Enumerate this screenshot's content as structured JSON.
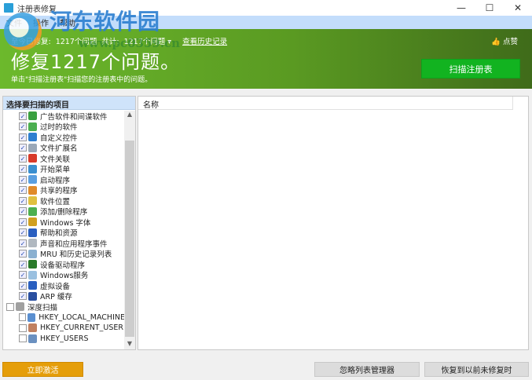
{
  "window": {
    "title": "注册表修复",
    "minimize": "—",
    "maximize": "☐",
    "close": "✕"
  },
  "menu": [
    "文件",
    "操作",
    "帮助"
  ],
  "watermark": {
    "name": "河东软件园",
    "url": "www.pc0359.cn"
  },
  "header": {
    "fixed_label": "至今已修复:",
    "fixed_count": "1217个问题",
    "total_label": "共计:",
    "total_count": "1217个问题 ▾",
    "history_link": "查看历史记录",
    "like": "点赞",
    "headline": "修复1217个问题。",
    "subtitle": "单击\"扫描注册表\"扫描您的注册表中的问题。",
    "scan_button": "扫描注册表"
  },
  "left_panel": {
    "title": "选择要扫描的项目",
    "items": [
      {
        "label": "广告软件和间谍软件",
        "checked": true,
        "color": "#3aa040",
        "indent": 1
      },
      {
        "label": "过时的软件",
        "checked": true,
        "color": "#4caf50",
        "indent": 1
      },
      {
        "label": "自定义控件",
        "checked": true,
        "color": "#2f7fd0",
        "indent": 1
      },
      {
        "label": "文件扩展名",
        "checked": true,
        "color": "#9aa8b8",
        "indent": 1
      },
      {
        "label": "文件关联",
        "checked": true,
        "color": "#d83a2a",
        "indent": 1
      },
      {
        "label": "开始菜单",
        "checked": true,
        "color": "#3a8fd0",
        "indent": 1
      },
      {
        "label": "启动程序",
        "checked": true,
        "color": "#5a9fe0",
        "indent": 1
      },
      {
        "label": "共享的程序",
        "checked": true,
        "color": "#e08a2a",
        "indent": 1
      },
      {
        "label": "软件位置",
        "checked": true,
        "color": "#e0c040",
        "indent": 1
      },
      {
        "label": "添加/删除程序",
        "checked": true,
        "color": "#4caf50",
        "indent": 1
      },
      {
        "label": "Windows 字体",
        "checked": true,
        "color": "#d0a020",
        "indent": 1
      },
      {
        "label": "帮助和资源",
        "checked": true,
        "color": "#2a5fc0",
        "indent": 1
      },
      {
        "label": "声音和应用程序事件",
        "checked": true,
        "color": "#b0b8c0",
        "indent": 1
      },
      {
        "label": "MRU 和历史记录列表",
        "checked": true,
        "color": "#8ab0d0",
        "indent": 1
      },
      {
        "label": "设备驱动程序",
        "checked": true,
        "color": "#2a7a2a",
        "indent": 1
      },
      {
        "label": "Windows服务",
        "checked": true,
        "color": "#9ac0e0",
        "indent": 1
      },
      {
        "label": "虚拟设备",
        "checked": true,
        "color": "#2a5fc0",
        "indent": 1
      },
      {
        "label": "ARP 缓存",
        "checked": true,
        "color": "#2a4fa0",
        "indent": 1
      },
      {
        "label": "深度扫描",
        "checked": false,
        "color": "#a0a0a0",
        "indent": 0
      },
      {
        "label": "HKEY_LOCAL_MACHINE",
        "checked": false,
        "color": "#5a8fd0",
        "indent": 1
      },
      {
        "label": "HKEY_CURRENT_USER",
        "checked": false,
        "color": "#c08060",
        "indent": 1
      },
      {
        "label": "HKEY_USERS",
        "checked": false,
        "color": "#6a90c0",
        "indent": 1
      }
    ]
  },
  "right_panel": {
    "column": "名称"
  },
  "footer": {
    "activate": "立即激活",
    "ignore_list": "忽略列表管理器",
    "restore": "恢复到以前未修复时"
  },
  "colors": {
    "accent_green": "#12b320",
    "activate_orange": "#e59e0a"
  }
}
